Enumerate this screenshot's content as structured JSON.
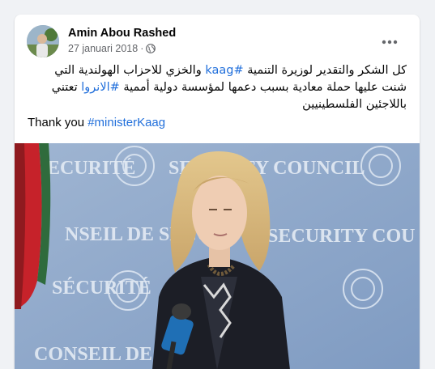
{
  "post": {
    "author": "Amin Abou Rashed",
    "date": "27 januari 2018",
    "separator": "·",
    "visibility_icon": "globe-icon",
    "more_icon": "more-options-icon",
    "arabic_part1": "كل الشكر والتقدير لوزيرة التنمية ",
    "arabic_hashtag1": "#kaag",
    "arabic_part2": " والخزي للاحزاب الهولندية التي شنت عليها حملة معادية بسبب دعمها لمؤسسة دولية أممية ",
    "arabic_hashtag2": "#الانروا",
    "arabic_part3": " تعتني باللاجئين الفلسطينيين",
    "english_part1": "Thank you ",
    "english_hashtag": "#ministerKaag"
  },
  "photo": {
    "wall_text_rows": [
      "ECURITÉ",
      "SECURITY COUNCIL",
      "NSEIL DE SÉCU",
      "SECURITY COU",
      "SÉCURITÉ",
      "CONSEIL DE SÉCURITÉ"
    ],
    "microphone_icon": "microphone-icon"
  },
  "colors": {
    "link": "#216fdb",
    "secondary_text": "#65676b",
    "wall_blue": "#8ea6c8"
  }
}
